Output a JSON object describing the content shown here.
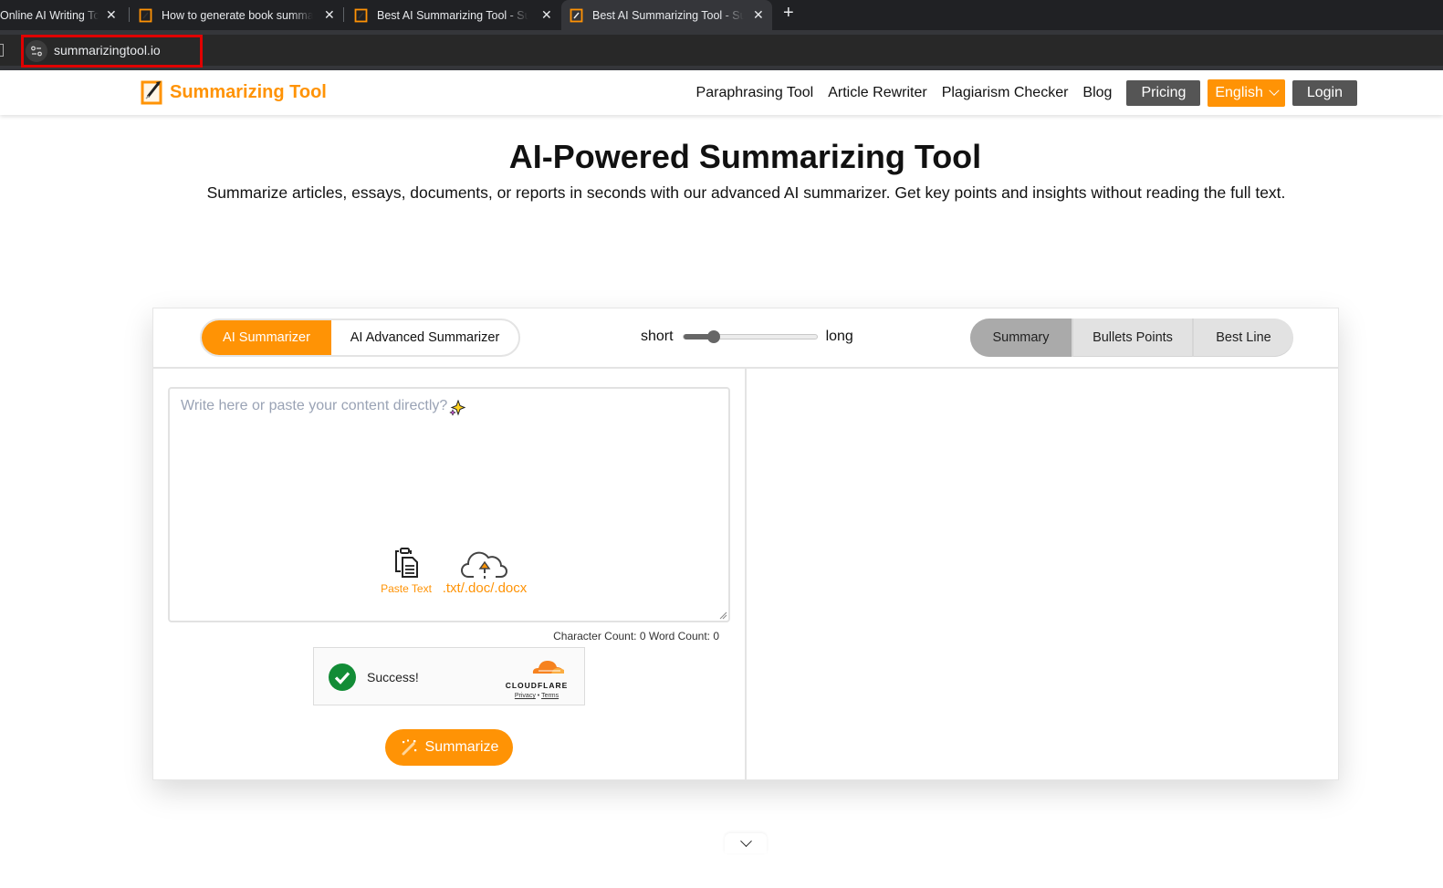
{
  "browser": {
    "tabs": [
      {
        "title": "Online AI Writing Tools",
        "active": false
      },
      {
        "title": "How to generate book summaries",
        "active": false
      },
      {
        "title": "Best AI Summarizing Tool - Summarize",
        "active": false
      },
      {
        "title": "Best AI Summarizing Tool - Summarize",
        "active": true
      }
    ],
    "new_tab_label": "+",
    "close_label": "✕",
    "url": "summarizingtool.io"
  },
  "header": {
    "logo_text": "Summarizing Tool",
    "nav": [
      {
        "label": "Paraphrasing Tool"
      },
      {
        "label": "Article Rewriter"
      },
      {
        "label": "Plagiarism Checker"
      },
      {
        "label": "Blog"
      }
    ],
    "pricing_label": "Pricing",
    "language_label": "English",
    "login_label": "Login"
  },
  "hero": {
    "title": "AI-Powered Summarizing Tool",
    "subtitle": "Summarize articles, essays, documents, or reports in seconds with our advanced AI summarizer. Get key points and insights without reading the full text."
  },
  "tool": {
    "modes": [
      {
        "label": "AI Summarizer",
        "active": true
      },
      {
        "label": "AI Advanced Summarizer",
        "active": false
      }
    ],
    "length": {
      "min_label": "short",
      "max_label": "long",
      "value_percent": 23
    },
    "output_tabs": [
      {
        "label": "Summary",
        "active": true
      },
      {
        "label": "Bullets Points",
        "active": false
      },
      {
        "label": "Best Line",
        "active": false
      }
    ],
    "editor": {
      "value": "",
      "placeholder": "Write here or paste your content directly?"
    },
    "paste_label": "Paste Text",
    "upload_label": ".txt/.doc/.docx",
    "counts": "Character Count: 0 Word Count: 0",
    "captcha": {
      "status": "Success!",
      "provider": "CLOUDFLARE",
      "privacy_label": "Privacy",
      "separator": "•",
      "terms_label": "Terms"
    },
    "summarize_label": "Summarize"
  },
  "colors": {
    "brand_orange": "#ff9305",
    "dark_button": "#555555",
    "success_green": "#128c36",
    "highlight_red": "#e00000"
  }
}
